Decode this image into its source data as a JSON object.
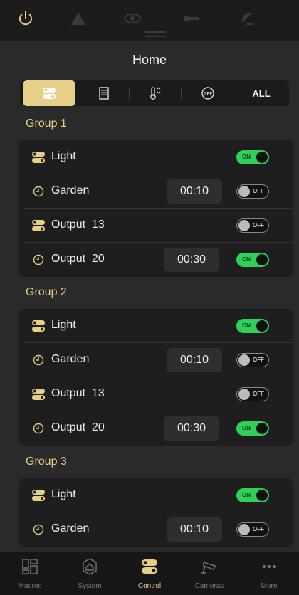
{
  "header": {
    "title": "Home"
  },
  "top_icons": [
    "power-icon",
    "warning-icon",
    "eye-icon",
    "key-icon",
    "satellite-dish-icon"
  ],
  "filter_tabs": [
    {
      "name": "switches-icon",
      "active": true
    },
    {
      "name": "panel-icon"
    },
    {
      "name": "thermometer-icon"
    },
    {
      "name": "off-icon",
      "label": "OFF"
    },
    {
      "name": "all",
      "label": "ALL"
    }
  ],
  "groups": [
    {
      "title": "Group 1",
      "items": [
        {
          "icon": "switch-icon",
          "label": "Light",
          "timer": "",
          "state": "on"
        },
        {
          "icon": "clock-icon",
          "label": "Garden",
          "timer": "00:10",
          "state": "off"
        },
        {
          "icon": "switch-icon",
          "label": "Output  13",
          "timer": "",
          "state": "off"
        },
        {
          "icon": "clock-icon",
          "label": "Output  20",
          "timer": "00:30",
          "state": "on"
        }
      ]
    },
    {
      "title": "Group 2",
      "items": [
        {
          "icon": "switch-icon",
          "label": "Light",
          "timer": "",
          "state": "on"
        },
        {
          "icon": "clock-icon",
          "label": "Garden",
          "timer": "00:10",
          "state": "off"
        },
        {
          "icon": "switch-icon",
          "label": "Output  13",
          "timer": "",
          "state": "off"
        },
        {
          "icon": "clock-icon",
          "label": "Output  20",
          "timer": "00:30",
          "state": "on"
        }
      ]
    },
    {
      "title": "Group 3",
      "items": [
        {
          "icon": "switch-icon",
          "label": "Light",
          "timer": "",
          "state": "on"
        },
        {
          "icon": "clock-icon",
          "label": "Garden",
          "timer": "00:10",
          "state": "off"
        }
      ]
    }
  ],
  "toggle_labels": {
    "on": "ON",
    "off": "OFF"
  },
  "tabbar": [
    {
      "icon": "macros-icon",
      "label": "Macros"
    },
    {
      "icon": "system-icon",
      "label": "System"
    },
    {
      "icon": "control-icon",
      "label": "Control",
      "active": true
    },
    {
      "icon": "cameras-icon",
      "label": "Cameras"
    },
    {
      "icon": "more-icon",
      "label": "More"
    }
  ],
  "colors": {
    "accent": "#e8cf88",
    "toggle_on": "#2fcf58",
    "background": "#2a2a2a",
    "card": "#1e1e1e"
  }
}
